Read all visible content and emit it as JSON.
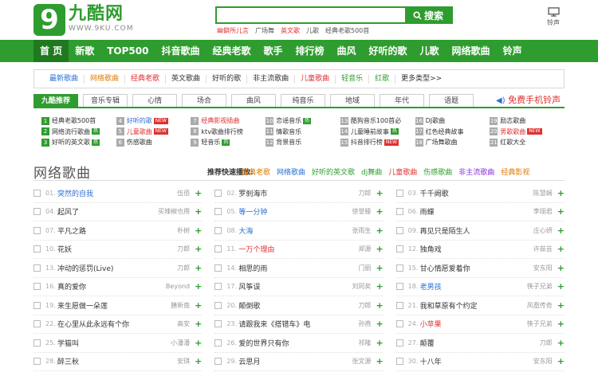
{
  "header": {
    "logo_mark": "9",
    "logo_name": "九酷网",
    "logo_url": "WWW.9KU.COM",
    "search_placeholder": "",
    "search_button": "搜索",
    "hot_words": [
      {
        "text": "幽僻所儿言",
        "red": true
      },
      {
        "text": "广场舞",
        "red": false
      },
      {
        "text": "英文歌",
        "red": true
      },
      {
        "text": "儿歌",
        "red": false
      },
      {
        "text": "经典老歌500首",
        "red": false
      }
    ],
    "ringtone_label": "铃声"
  },
  "nav": [
    "首 页",
    "新歌",
    "TOP500",
    "抖音歌曲",
    "经典老歌",
    "歌手",
    "排行榜",
    "曲风",
    "好听的歌",
    "儿歌",
    "网络歌曲",
    "铃声"
  ],
  "type_bar": [
    {
      "text": "最新歌曲",
      "color": "#2a6fd6"
    },
    {
      "text": "网络歌曲",
      "color": "#e07a00"
    },
    {
      "text": "经典老歌",
      "color": "#e03030"
    },
    {
      "text": "英文歌曲",
      "color": "#333333"
    },
    {
      "text": "好听的歌",
      "color": "#333333"
    },
    {
      "text": "非主流歌曲",
      "color": "#333333"
    },
    {
      "text": "儿童歌曲",
      "color": "#e03030"
    },
    {
      "text": "轻音乐",
      "color": "#2f9c2f"
    },
    {
      "text": "红歌",
      "color": "#2f9c2f"
    },
    {
      "text": "更多类型>>",
      "color": "#333333"
    }
  ],
  "tabs": [
    "九酷推荐",
    "音乐专辑",
    "心情",
    "场合",
    "曲风",
    "纯音乐",
    "地域",
    "年代",
    "语题"
  ],
  "free_ringtone": "免费手机铃声",
  "rec": [
    {
      "n": "1",
      "text": "经典老歌500首",
      "color": "#333333",
      "numc": "#2f9c2f",
      "badge": ""
    },
    {
      "n": "4",
      "text": "好听的歌",
      "color": "#2a6fd6",
      "numc": "#aaaaaa",
      "badge": "NEW"
    },
    {
      "n": "7",
      "text": "经典影视插曲",
      "color": "#e03030",
      "numc": "#aaaaaa",
      "badge": ""
    },
    {
      "n": "10",
      "text": "恋谣音乐",
      "color": "#333333",
      "numc": "#aaaaaa",
      "badge": "热"
    },
    {
      "n": "13",
      "text": "酷狗音乐100首必",
      "color": "#333333",
      "numc": "#aaaaaa",
      "badge": ""
    },
    {
      "n": "16",
      "text": "DJ歌曲",
      "color": "#333333",
      "numc": "#aaaaaa",
      "badge": ""
    },
    {
      "n": "19",
      "text": "励志歌曲",
      "color": "#333333",
      "numc": "#aaaaaa",
      "badge": ""
    },
    {
      "n": "2",
      "text": "网络流行歌曲",
      "color": "#333333",
      "numc": "#2f9c2f",
      "badge": "热"
    },
    {
      "n": "5",
      "text": "儿童歌曲",
      "color": "#e03030",
      "numc": "#aaaaaa",
      "badge": "NEW"
    },
    {
      "n": "8",
      "text": "ktv歌曲排行榜",
      "color": "#333333",
      "numc": "#aaaaaa",
      "badge": ""
    },
    {
      "n": "11",
      "text": "情歌音乐",
      "color": "#333333",
      "numc": "#aaaaaa",
      "badge": ""
    },
    {
      "n": "14",
      "text": "儿童睡前故事",
      "color": "#333333",
      "numc": "#aaaaaa",
      "badge": "热"
    },
    {
      "n": "17",
      "text": "红色经典故事",
      "color": "#333333",
      "numc": "#aaaaaa",
      "badge": ""
    },
    {
      "n": "20",
      "text": "男歌歌曲",
      "color": "#e03030",
      "numc": "#aaaaaa",
      "badge": "NEW"
    },
    {
      "n": "3",
      "text": "好听的英文歌",
      "color": "#333333",
      "numc": "#2f9c2f",
      "badge": "热"
    },
    {
      "n": "6",
      "text": "伤感歌曲",
      "color": "#333333",
      "numc": "#aaaaaa",
      "badge": ""
    },
    {
      "n": "9",
      "text": "轻音乐",
      "color": "#333333",
      "numc": "#aaaaaa",
      "badge": "热"
    },
    {
      "n": "12",
      "text": "背景音乐",
      "color": "#333333",
      "numc": "#aaaaaa",
      "badge": ""
    },
    {
      "n": "15",
      "text": "抖音排行榜",
      "color": "#333333",
      "numc": "#aaaaaa",
      "badge": "NEW"
    },
    {
      "n": "18",
      "text": "广场舞歌曲",
      "color": "#333333",
      "numc": "#aaaaaa",
      "badge": ""
    },
    {
      "n": "21",
      "text": "红歌大全",
      "color": "#333333",
      "numc": "#aaaaaa",
      "badge": ""
    }
  ],
  "section": {
    "title": "网络歌曲",
    "quick_label": "推荐快速播放:",
    "quick_links": [
      {
        "text": "经典老歌",
        "color": "#e07a00"
      },
      {
        "text": "网络歌曲",
        "color": "#2a6fd6"
      },
      {
        "text": "好听的英文歌",
        "color": "#2f9c2f"
      },
      {
        "text": "dj舞曲",
        "color": "#2f9c2f"
      },
      {
        "text": "儿童歌曲",
        "color": "#e03030"
      },
      {
        "text": "伤感歌曲",
        "color": "#2f9c2f"
      },
      {
        "text": "非主流歌曲",
        "color": "#8a2be2"
      },
      {
        "text": "经典影视",
        "color": "#e07a00"
      }
    ]
  },
  "songs": [
    {
      "n": "01.",
      "title": "突然的自我",
      "artist": "伍佰",
      "color": "#2a6fd6"
    },
    {
      "n": "02.",
      "title": "罗刹海市",
      "artist": "刀郎",
      "color": "#333333"
    },
    {
      "n": "03.",
      "title": "千千阙歌",
      "artist": "陈慧娴",
      "color": "#333333"
    },
    {
      "n": "04.",
      "title": "起风了",
      "artist": "买辣椒也用",
      "color": "#333333"
    },
    {
      "n": "05.",
      "title": "等一分钟",
      "artist": "徐誉滕",
      "color": "#2a6fd6"
    },
    {
      "n": "06.",
      "title": "雨蝶",
      "artist": "李翊君",
      "color": "#333333"
    },
    {
      "n": "07.",
      "title": "平凡之路",
      "artist": "朴树",
      "color": "#333333"
    },
    {
      "n": "08.",
      "title": "大海",
      "artist": "张雨生",
      "color": "#2a6fd6"
    },
    {
      "n": "09.",
      "title": "再见只是陌生人",
      "artist": "庄心妍",
      "color": "#333333"
    },
    {
      "n": "10.",
      "title": "花妖",
      "artist": "刀郎",
      "color": "#333333"
    },
    {
      "n": "11.",
      "title": "一万个理由",
      "artist": "郑源",
      "color": "#e03030"
    },
    {
      "n": "12.",
      "title": "独角戏",
      "artist": "许茹芸",
      "color": "#333333"
    },
    {
      "n": "13.",
      "title": "冲动的惩罚(Live)",
      "artist": "刀郎",
      "color": "#333333"
    },
    {
      "n": "14.",
      "title": "相思的雨",
      "artist": "门丽",
      "color": "#333333"
    },
    {
      "n": "15.",
      "title": "甘心情愿爱着你",
      "artist": "安东阳",
      "color": "#333333"
    },
    {
      "n": "16.",
      "title": "真的爱你",
      "artist": "Beyond",
      "color": "#333333"
    },
    {
      "n": "17.",
      "title": "风筝误",
      "artist": "刘珂矣",
      "color": "#333333"
    },
    {
      "n": "18.",
      "title": "老男孩",
      "artist": "筷子兄弟",
      "color": "#2a6fd6"
    },
    {
      "n": "19.",
      "title": "来生愿做一朵莲",
      "artist": "膳新南",
      "color": "#333333"
    },
    {
      "n": "20.",
      "title": "颠倒歌",
      "artist": "刀郎",
      "color": "#333333"
    },
    {
      "n": "21.",
      "title": "我和草原有个约定",
      "artist": "凤凰传奇",
      "color": "#333333"
    },
    {
      "n": "22.",
      "title": "在心里从此永远有个你",
      "artist": "高安",
      "color": "#333333"
    },
    {
      "n": "23.",
      "title": "请跟我来《搭错车》电",
      "artist": "孙燕",
      "color": "#333333"
    },
    {
      "n": "24.",
      "title": "小苹果",
      "artist": "筷子兄弟",
      "color": "#e03030"
    },
    {
      "n": "25.",
      "title": "学猫叫",
      "artist": "小潘潘",
      "color": "#333333"
    },
    {
      "n": "26.",
      "title": "爱的世界只有你",
      "artist": "祁隆",
      "color": "#333333"
    },
    {
      "n": "27.",
      "title": "颠覆",
      "artist": "刀郎",
      "color": "#333333"
    },
    {
      "n": "28.",
      "title": "醉三秋",
      "artist": "安琪",
      "color": "#333333"
    },
    {
      "n": "29.",
      "title": "云思月",
      "artist": "张文源",
      "color": "#333333"
    },
    {
      "n": "30.",
      "title": "十八年",
      "artist": "安东阳",
      "color": "#333333"
    }
  ],
  "add_symbol": "+"
}
